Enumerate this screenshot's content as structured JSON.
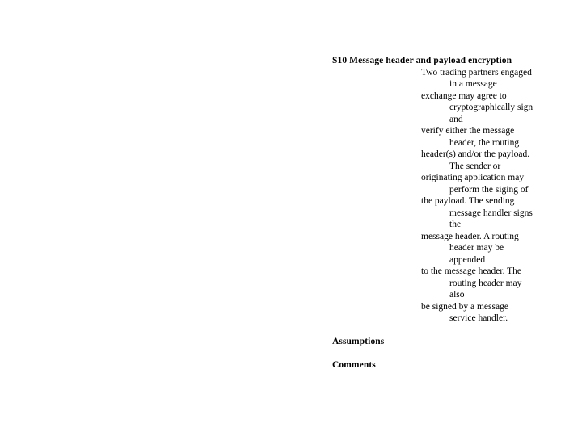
{
  "document": {
    "background_color": "#ffffff",
    "text_color": "#000000"
  },
  "section": {
    "id": "S10",
    "heading": "S10 Message header and payload encryption",
    "body_text": "Two trading partners engaged in a message exchange may agree to cryptographically sign and verify either the message header, the routing header(s) and/or the payload. The sender or originating application may perform the siging of the payload. The sending message handler signs the message header. A routing header may be appended to the message header. The routing header may also be signed by a message service handler.",
    "body_lines": [
      {
        "text": "Two trading partners engaged",
        "indent": 0
      },
      {
        "text": "in a message",
        "indent": 1
      },
      {
        "text": "exchange may agree to",
        "indent": 0
      },
      {
        "text": "cryptographically sign",
        "indent": 1
      },
      {
        "text": "and",
        "indent": 1
      },
      {
        "text": "verify either the message",
        "indent": 0
      },
      {
        "text": "header, the routing",
        "indent": 1
      },
      {
        "text": "header(s) and/or the payload.",
        "indent": 0
      },
      {
        "text": "The sender or",
        "indent": 1
      },
      {
        "text": "originating application may",
        "indent": 0
      },
      {
        "text": "perform the siging of",
        "indent": 1
      },
      {
        "text": "the payload. The sending",
        "indent": 0
      },
      {
        "text": "message handler signs",
        "indent": 1
      },
      {
        "text": "the",
        "indent": 1
      },
      {
        "text": "message header. A routing",
        "indent": 0
      },
      {
        "text": "header may be",
        "indent": 1
      },
      {
        "text": "appended",
        "indent": 1
      },
      {
        "text": "to the message header. The",
        "indent": 0
      },
      {
        "text": "routing header may",
        "indent": 1
      },
      {
        "text": "also",
        "indent": 1
      },
      {
        "text": "be signed by a message",
        "indent": 0
      },
      {
        "text": "service handler.",
        "indent": 1
      }
    ]
  },
  "fields": {
    "assumptions": {
      "label": "Assumptions",
      "value": ""
    },
    "comments": {
      "label": "Comments",
      "value": ""
    }
  }
}
